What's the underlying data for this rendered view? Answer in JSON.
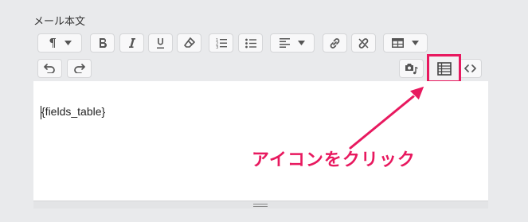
{
  "field": {
    "label": "メール本文"
  },
  "editor": {
    "content": "{fields_table}"
  },
  "annotation": {
    "text": "アイコンをクリック",
    "color": "#e8195f"
  },
  "toolbar": {
    "row1": [
      "paragraph-icon",
      "bold-icon",
      "italic-icon",
      "underline-icon",
      "eraser-icon",
      "ordered-list-icon",
      "unordered-list-icon",
      "align-icon",
      "link-icon",
      "unlink-icon",
      "table-icon"
    ],
    "row2": [
      "undo-icon",
      "redo-icon",
      "media-icon",
      "fields-table-icon",
      "code-view-icon"
    ]
  }
}
